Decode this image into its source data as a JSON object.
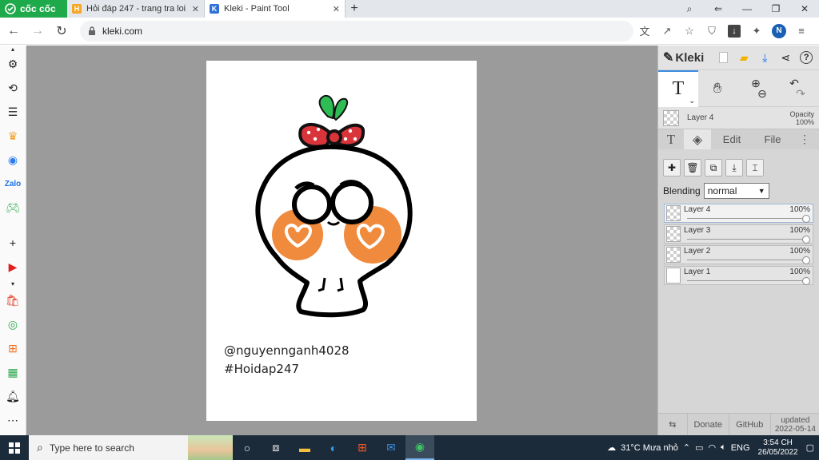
{
  "browser": {
    "name": "cốc cốc",
    "tabs": [
      {
        "title": "Hỏi đáp 247 - trang tra loi",
        "active": false
      },
      {
        "title": "Kleki - Paint Tool",
        "active": true
      }
    ],
    "url": "kleki.com",
    "profile_initial": "N"
  },
  "canvas": {
    "signature_line1": "@nguyennganh4028",
    "signature_line2": "#Hoidap247"
  },
  "kleki": {
    "logo": "Kleki",
    "current_tool": "T",
    "layer_name": "Layer 4",
    "opacity_label": "Opacity",
    "opacity_value": "100%",
    "tabs": [
      "Edit",
      "File"
    ],
    "blending_label": "Blending",
    "blending_value": "normal",
    "layers": [
      {
        "name": "Layer 4",
        "opacity": "100%",
        "selected": true
      },
      {
        "name": "Layer 3",
        "opacity": "100%",
        "selected": false
      },
      {
        "name": "Layer 2",
        "opacity": "100%",
        "selected": false
      },
      {
        "name": "Layer 1",
        "opacity": "100%",
        "selected": false
      }
    ],
    "footer": {
      "donate": "Donate",
      "github": "GitHub",
      "updated_label": "updated",
      "updated_date": "2022-05-14"
    }
  },
  "taskbar": {
    "search_placeholder": "Type here to search",
    "weather": "31°C  Mưa nhỏ",
    "language": "ENG",
    "time": "3:54 CH",
    "date": "26/05/2022"
  },
  "colors": {
    "browser_green": "#1eaa4a",
    "accent_blue": "#3c8ce0",
    "cheek_orange": "#f08a3c",
    "bow_red": "#d8343a",
    "leaf_green": "#2ebd55"
  }
}
